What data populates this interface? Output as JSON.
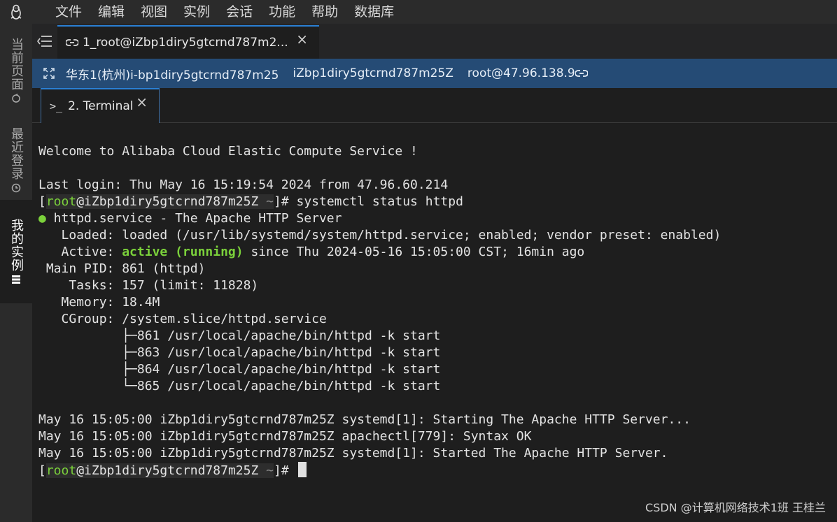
{
  "menubar": {
    "items": [
      "文件",
      "编辑",
      "视图",
      "实例",
      "会话",
      "功能",
      "帮助",
      "数据库"
    ]
  },
  "sidebar": {
    "current_page": "当前页面",
    "recent_login": "最近登录",
    "my_instances": "我的实例"
  },
  "session_tab": {
    "label": "1_root@iZbp1diry5gtcrnd787m2...",
    "close": "×"
  },
  "info_bar": {
    "region": "华东1(杭州)i-bp1diry5gtcrnd787m25",
    "hostname": "iZbp1diry5gtcrnd787m25Z",
    "user_ip": "root@47.96.138.9"
  },
  "terminal_tab": {
    "label": "2. Terminal",
    "close": "×"
  },
  "terminal": {
    "welcome": "Welcome to Alibaba Cloud Elastic Compute Service !",
    "last_login": "Last login: Thu May 16 15:19:54 2024 from 47.96.60.214",
    "prompt": {
      "user": "root",
      "host": "@iZbp1diry5gtcrnd787m25Z",
      "dir": "~"
    },
    "command": "systemctl status httpd",
    "status_dot": "●",
    "service_line": " httpd.service - The Apache HTTP Server",
    "loaded": "   Loaded: loaded (/usr/lib/systemd/system/httpd.service; enabled; vendor preset: enabled)",
    "active_prefix": "   Active: ",
    "active_state": "active (running)",
    "active_suffix": " since Thu 2024-05-16 15:05:00 CST; 16min ago",
    "main_pid": " Main PID: 861 (httpd)",
    "tasks": "    Tasks: 157 (limit: 11828)",
    "memory": "   Memory: 18.4M",
    "cgroup": "   CGroup: /system.slice/httpd.service",
    "cgroup_children": [
      "           ├─861 /usr/local/apache/bin/httpd -k start",
      "           ├─863 /usr/local/apache/bin/httpd -k start",
      "           ├─864 /usr/local/apache/bin/httpd -k start",
      "           └─865 /usr/local/apache/bin/httpd -k start"
    ],
    "logs": [
      "May 16 15:05:00 iZbp1diry5gtcrnd787m25Z systemd[1]: Starting The Apache HTTP Server...",
      "May 16 15:05:00 iZbp1diry5gtcrnd787m25Z apachectl[779]: Syntax OK",
      "May 16 15:05:00 iZbp1diry5gtcrnd787m25Z systemd[1]: Started The Apache HTTP Server."
    ]
  },
  "watermark": "CSDN @计算机网络技术1班 王桂兰"
}
